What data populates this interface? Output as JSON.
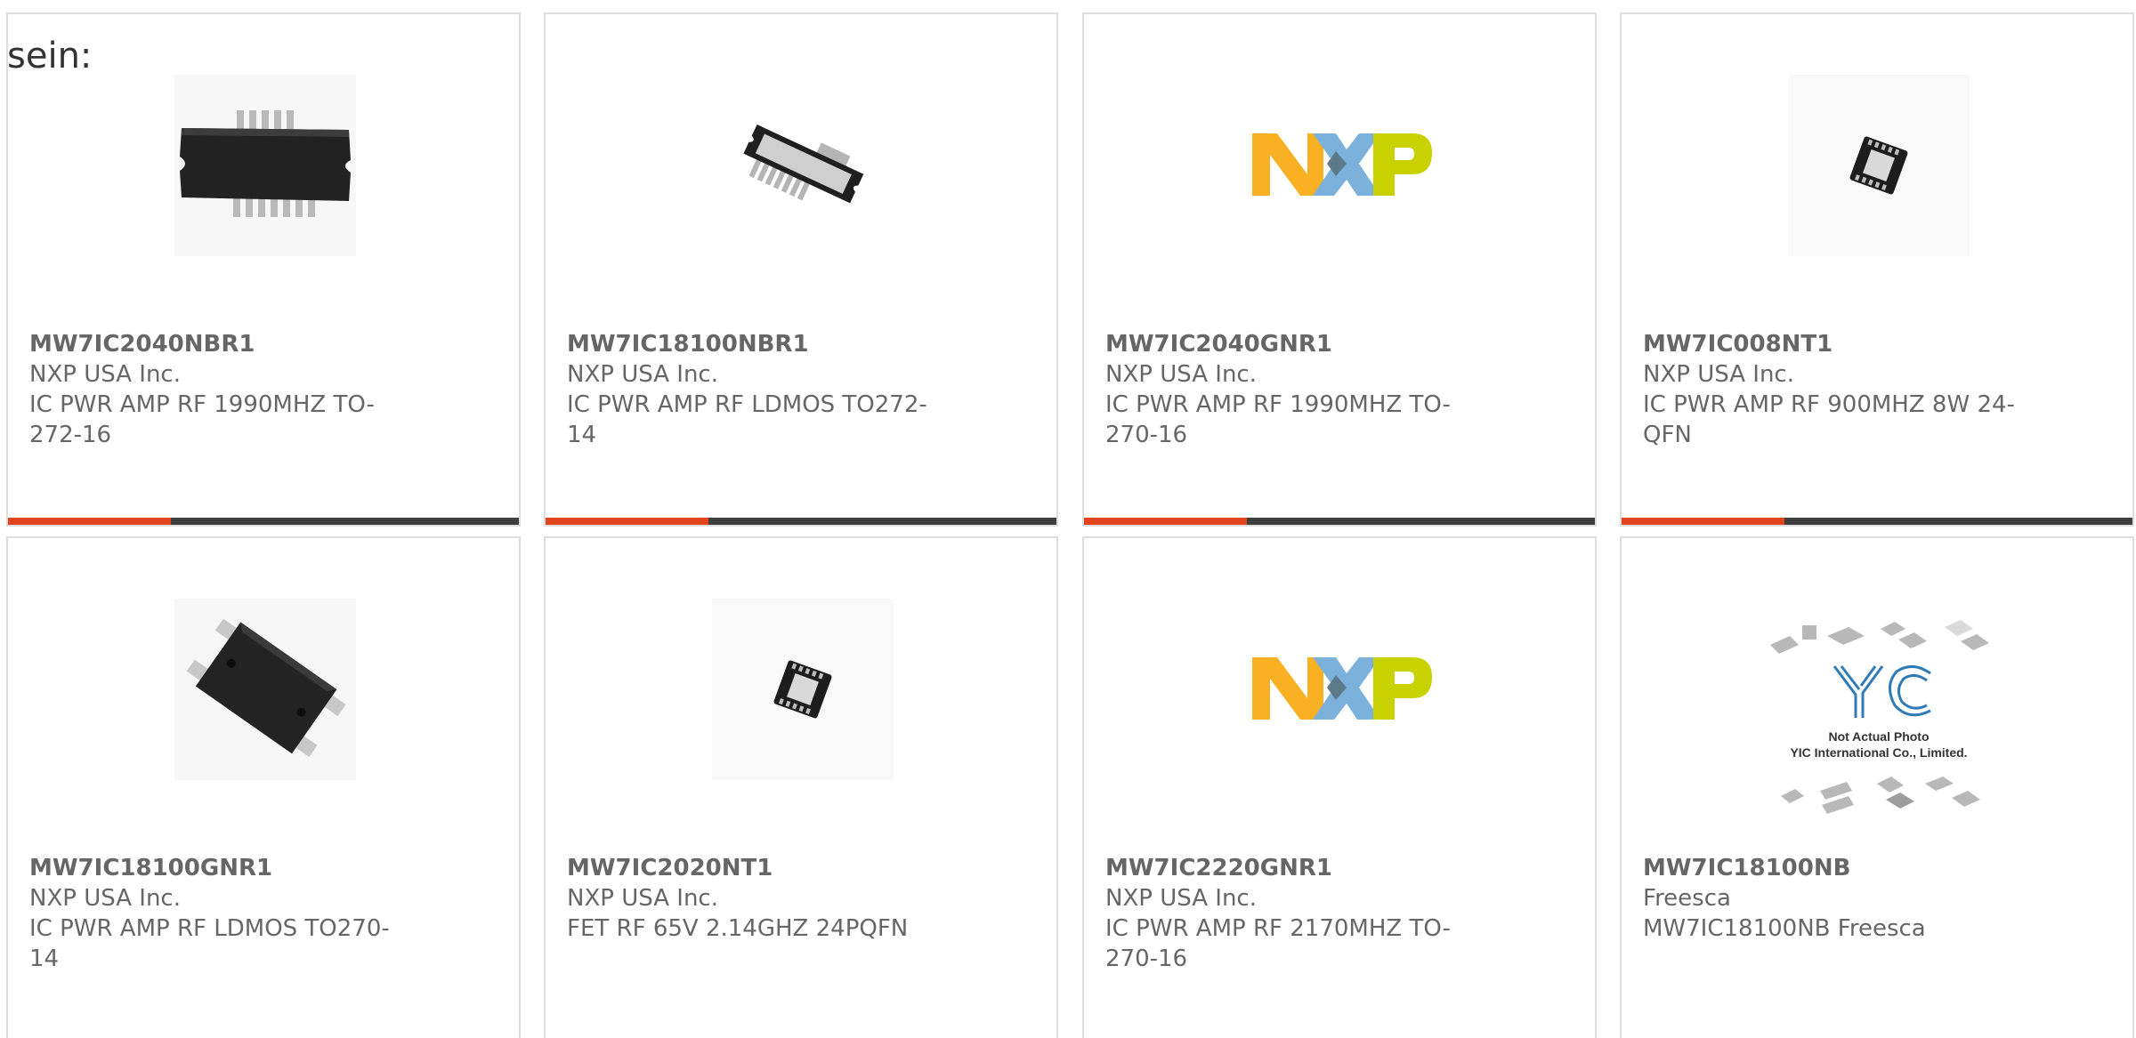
{
  "intro_text": "sein:",
  "products": [
    {
      "part_number": "MW7IC2040NBR1",
      "manufacturer": "NXP USA Inc.",
      "description": "IC PWR AMP RF 1990MHZ TO-272-16",
      "image": "to272-package-photo"
    },
    {
      "part_number": "MW7IC18100NBR1",
      "manufacturer": "NXP USA Inc.",
      "description": "IC PWR AMP RF LDMOS TO272-14",
      "image": "to272-package-photo"
    },
    {
      "part_number": "MW7IC2040GNR1",
      "manufacturer": "NXP USA Inc.",
      "description": "IC PWR AMP RF 1990MHZ TO-270-16",
      "image": "nxp-logo"
    },
    {
      "part_number": "MW7IC008NT1",
      "manufacturer": "NXP USA Inc.",
      "description": "IC PWR AMP RF 900MHZ 8W 24-QFN",
      "image": "qfn-chip-photo"
    },
    {
      "part_number": "MW7IC18100GNR1",
      "manufacturer": "NXP USA Inc.",
      "description": "IC PWR AMP RF LDMOS TO270-14",
      "image": "to270-package-photo"
    },
    {
      "part_number": "MW7IC2020NT1",
      "manufacturer": "NXP USA Inc.",
      "description": "FET RF 65V 2.14GHZ 24PQFN",
      "image": "qfn-chip-photo"
    },
    {
      "part_number": "MW7IC2220GNR1",
      "manufacturer": "NXP USA Inc.",
      "description": "IC PWR AMP RF 2170MHZ TO-270-16",
      "image": "nxp-logo"
    },
    {
      "part_number": "MW7IC18100NB",
      "manufacturer": "Freesca",
      "description": "MW7IC18100NB Freesca",
      "image": "placeholder-not-actual-photo",
      "placeholder_caption_1": "Not Actual Photo",
      "placeholder_caption_2": "YIC International Co., Limited."
    }
  ],
  "colors": {
    "card_border": "#dedede",
    "bar_dark": "#3f3f3f",
    "bar_accent": "#e2431a",
    "text": "#666666",
    "nxp_orange": "#f9b123",
    "nxp_blue": "#7bb1db",
    "nxp_green": "#c9d200"
  }
}
